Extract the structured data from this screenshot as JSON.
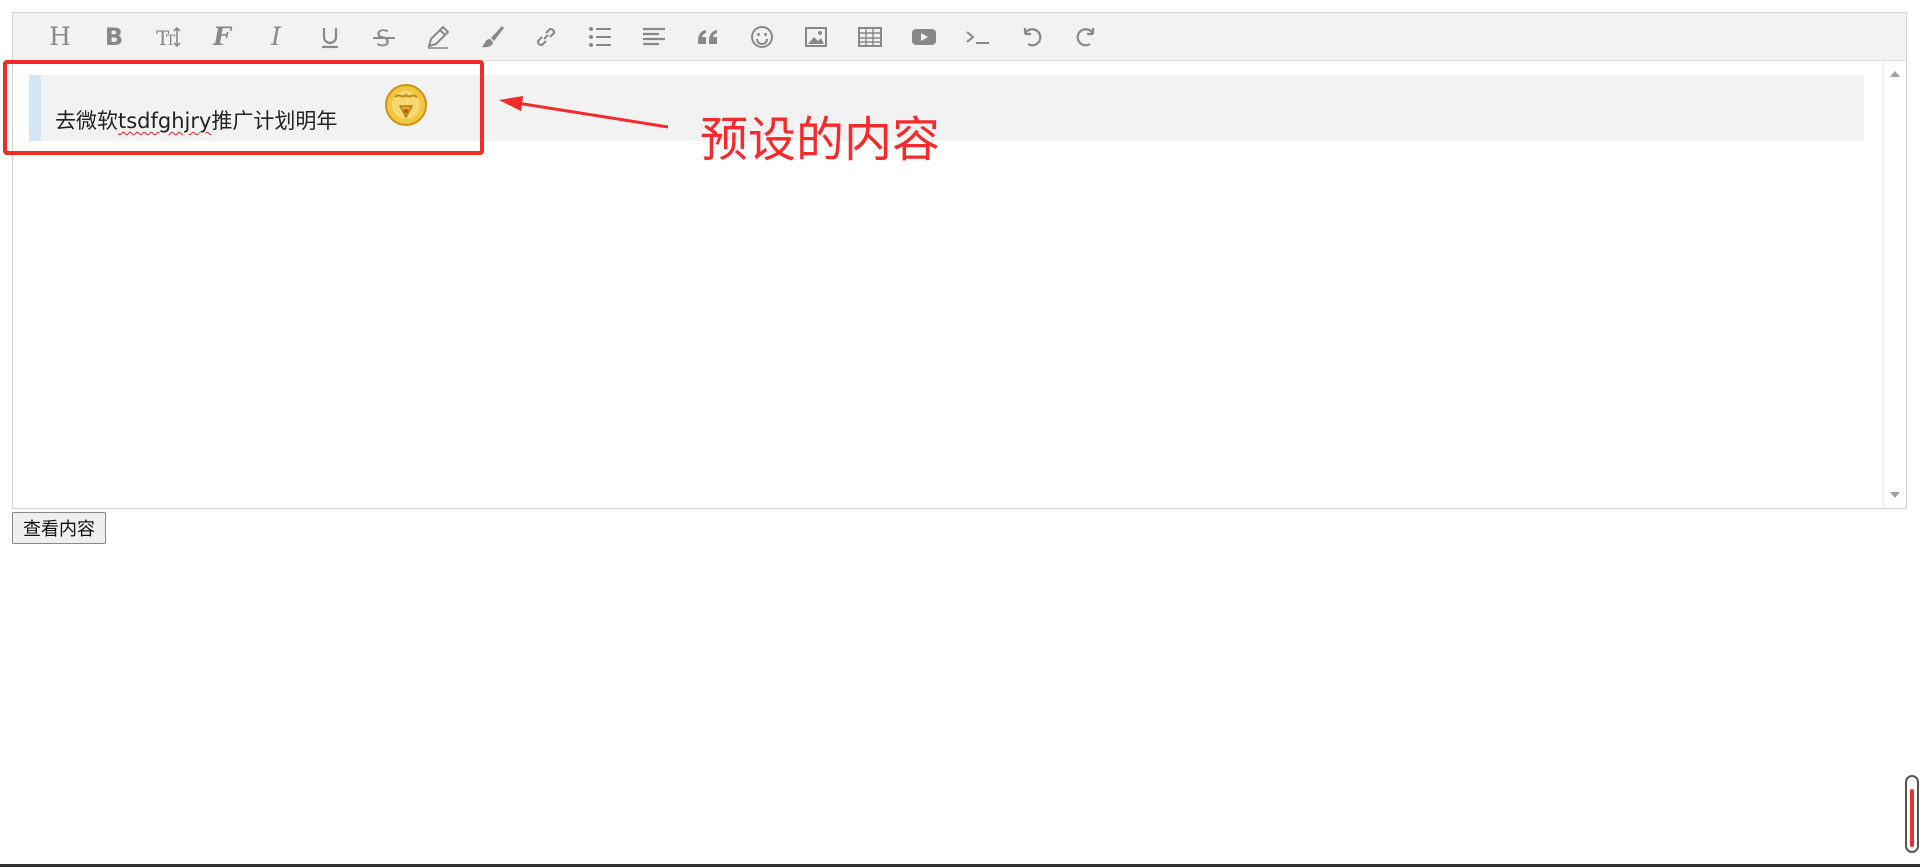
{
  "toolbar": {
    "buttons": [
      {
        "name": "heading-button",
        "icon": "heading-icon"
      },
      {
        "name": "bold-button",
        "icon": "bold-icon"
      },
      {
        "name": "font-size-button",
        "icon": "text-height-icon"
      },
      {
        "name": "font-family-button",
        "icon": "font-icon"
      },
      {
        "name": "italic-button",
        "icon": "italic-icon"
      },
      {
        "name": "underline-button",
        "icon": "underline-icon"
      },
      {
        "name": "strikethrough-button",
        "icon": "strikethrough-icon"
      },
      {
        "name": "fore-color-button",
        "icon": "pencil-icon"
      },
      {
        "name": "back-color-button",
        "icon": "brush-icon"
      },
      {
        "name": "link-button",
        "icon": "link-icon"
      },
      {
        "name": "list-button",
        "icon": "list-icon"
      },
      {
        "name": "justify-button",
        "icon": "align-left-icon"
      },
      {
        "name": "quote-button",
        "icon": "quote-icon"
      },
      {
        "name": "emoticon-button",
        "icon": "smile-icon"
      },
      {
        "name": "image-button",
        "icon": "image-icon"
      },
      {
        "name": "table-button",
        "icon": "table-icon"
      },
      {
        "name": "video-button",
        "icon": "video-icon"
      },
      {
        "name": "code-button",
        "icon": "terminal-icon"
      },
      {
        "name": "undo-button",
        "icon": "undo-icon"
      },
      {
        "name": "redo-button",
        "icon": "redo-icon"
      }
    ]
  },
  "editor": {
    "quote_text_prefix": "去微软",
    "quote_text_misspelled": "tsdfghjry",
    "quote_text_suffix": "推广计划明年",
    "emoji_icon": "emoticon-icon",
    "quote_border_color": "#d3e6f5"
  },
  "view_button": {
    "label": "查看内容"
  },
  "annotation": {
    "callout_text": "预设的内容",
    "color": "#f52a2a"
  }
}
